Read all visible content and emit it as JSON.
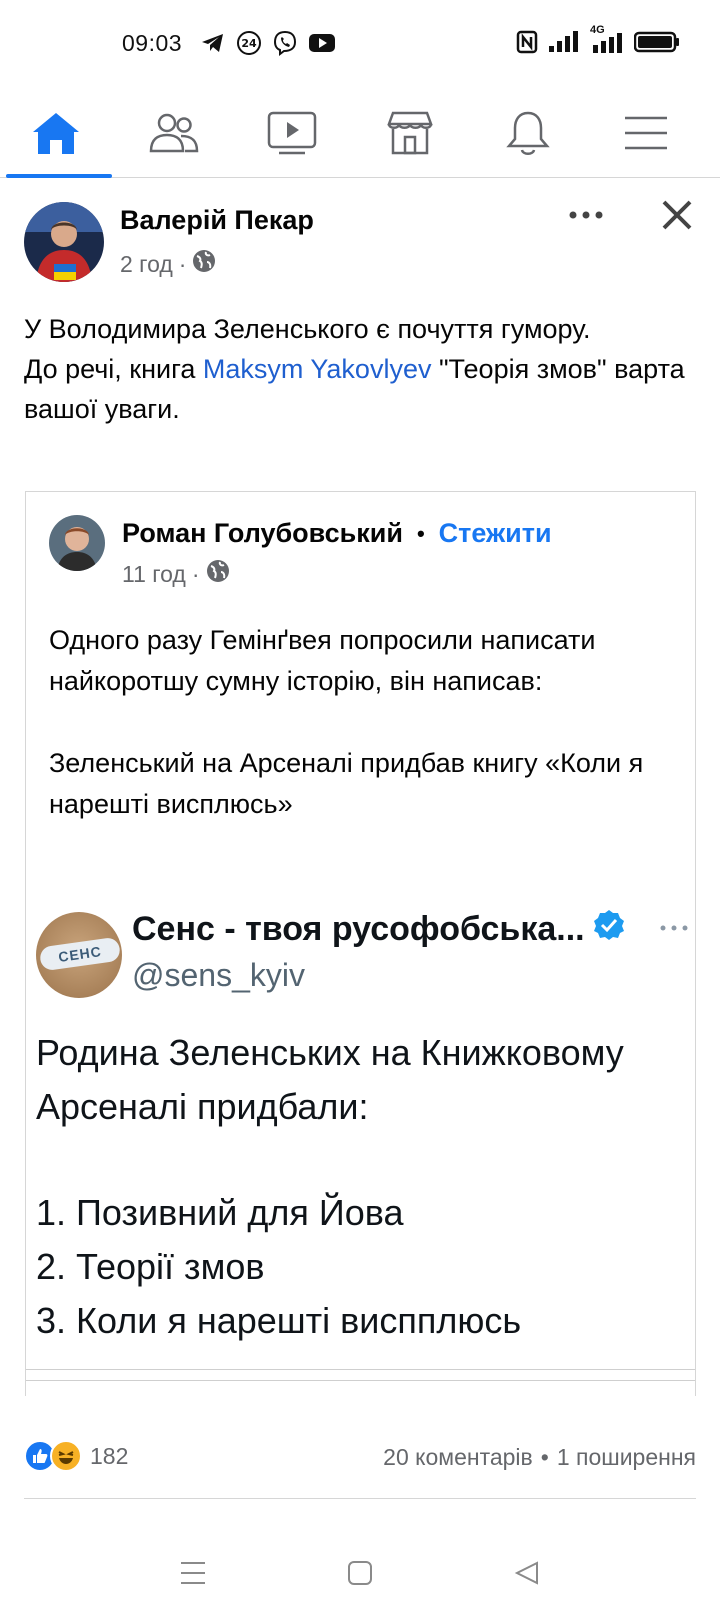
{
  "status_bar": {
    "time": "09:03",
    "left_icons": [
      "telegram-icon",
      "24-news-icon",
      "viber-icon",
      "youtube-icon"
    ],
    "right_icons": [
      "nfc-icon",
      "signal-icon",
      "4g-signal-icon",
      "battery-icon"
    ],
    "network_label": "4G"
  },
  "nav": {
    "items": [
      {
        "name": "home",
        "icon": "home-icon",
        "active": true
      },
      {
        "name": "friends",
        "icon": "friends-icon",
        "active": false
      },
      {
        "name": "watch",
        "icon": "video-icon",
        "active": false
      },
      {
        "name": "marketplace",
        "icon": "marketplace-icon",
        "active": false
      },
      {
        "name": "notifications",
        "icon": "bell-icon",
        "active": false
      },
      {
        "name": "menu",
        "icon": "menu-icon",
        "active": false
      }
    ],
    "accent_color": "#1877f2"
  },
  "post": {
    "author": "Валерій Пекар",
    "time": "2 год",
    "separator": "·",
    "privacy_icon": "globe-icon",
    "text_before_link": "У Володимира Зеленського є почуття гумору.\nДо речі, книга ",
    "link_text": "Maksym Yakovlyev",
    "text_after_link": " \"Теорія змов\" варта вашої уваги."
  },
  "shared": {
    "author": "Роман Голубовський",
    "dot": "•",
    "follow_label": "Стежити",
    "time": "11 год",
    "separator": "·",
    "text_line1": "Одного разу Гемінґвея попросили написати найкоротшу сумну історію, він написав:",
    "text_line2": "Зеленський на Арсеналі придбав книгу «Коли я нарешті висплюсь»"
  },
  "tweet": {
    "avatar_label": "СЕНС",
    "name": "Сенс - твоя русофобська...",
    "handle": "@sens_kyiv",
    "text_intro": "Родина Зеленських на Книжковому Арсеналі придбали:",
    "items": [
      "1. Позивний для Йова",
      "2. Теорії змов",
      "3. Коли я нарешті виспплюсь"
    ]
  },
  "engagement": {
    "reactions_count": "182",
    "reaction_icons": [
      "like-icon",
      "haha-icon"
    ],
    "comments": "20 коментарів",
    "bullet": "•",
    "shares": "1 поширення"
  },
  "system_nav": [
    "recent-apps-icon",
    "home-square-icon",
    "back-icon"
  ]
}
